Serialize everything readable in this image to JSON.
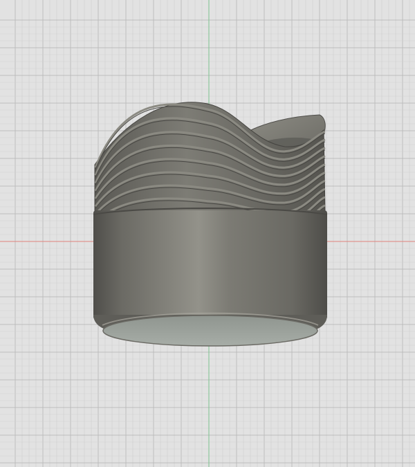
{
  "viewport": {
    "background_color": "#e2e2e2",
    "grid": {
      "visible": true,
      "minor_color": "#cfcfcf",
      "major_color": "#bdbdbd"
    },
    "axes": {
      "x_axis_color": "#e0837c",
      "y_axis_color": "#7cc28e"
    }
  },
  "model": {
    "body_color": "#77766f",
    "highlight_color": "#a3a29a",
    "shadow_color": "#55544f",
    "base_face_color": "#9aa19b",
    "ridge_color": "#8b8a82",
    "groove_color": "#4a4945"
  }
}
